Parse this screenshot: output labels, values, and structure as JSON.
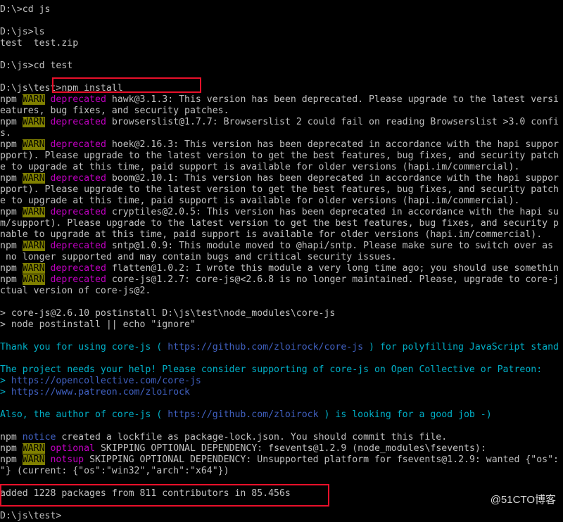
{
  "colors": {
    "default": "#c0c0c0",
    "warn_bg": "#808000",
    "warn_fg": "#000000",
    "deprecated": "#c000c0",
    "cyan": "#00b0c8",
    "notice": "#4060c0",
    "highlight": "#e8102a"
  },
  "lines": [
    [
      {
        "t": "D:\\>cd js"
      }
    ],
    [],
    [
      {
        "t": "D:\\js>ls"
      }
    ],
    [
      {
        "t": "test  test.zip"
      }
    ],
    [],
    [
      {
        "t": "D:\\js>cd test"
      }
    ],
    [],
    [
      {
        "t": "D:\\js\\test>npm install"
      }
    ],
    [
      {
        "t": "npm "
      },
      {
        "t": "WARN",
        "s": "warn"
      },
      {
        "t": " "
      },
      {
        "t": "deprecated",
        "s": "deprecated"
      },
      {
        "t": " hawk@3.1.3: This version has been deprecated. Please upgrade to the latest versi"
      }
    ],
    [
      {
        "t": "eatures, bug fixes, and security patches."
      }
    ],
    [
      {
        "t": "npm "
      },
      {
        "t": "WARN",
        "s": "warn"
      },
      {
        "t": " "
      },
      {
        "t": "deprecated",
        "s": "deprecated"
      },
      {
        "t": " browserslist@1.7.7: Browserslist 2 could fail on reading Browserslist >3.0 confi"
      }
    ],
    [
      {
        "t": "s."
      }
    ],
    [
      {
        "t": "npm "
      },
      {
        "t": "WARN",
        "s": "warn"
      },
      {
        "t": " "
      },
      {
        "t": "deprecated",
        "s": "deprecated"
      },
      {
        "t": " hoek@2.16.3: This version has been deprecated in accordance with the hapi suppor"
      }
    ],
    [
      {
        "t": "pport). Please upgrade to the latest version to get the best features, bug fixes, and security patch"
      }
    ],
    [
      {
        "t": "e to upgrade at this time, paid support is available for older versions (hapi.im/commercial)."
      }
    ],
    [
      {
        "t": "npm "
      },
      {
        "t": "WARN",
        "s": "warn"
      },
      {
        "t": " "
      },
      {
        "t": "deprecated",
        "s": "deprecated"
      },
      {
        "t": " boom@2.10.1: This version has been deprecated in accordance with the hapi suppor"
      }
    ],
    [
      {
        "t": "pport). Please upgrade to the latest version to get the best features, bug fixes, and security patch"
      }
    ],
    [
      {
        "t": "e to upgrade at this time, paid support is available for older versions (hapi.im/commercial)."
      }
    ],
    [
      {
        "t": "npm "
      },
      {
        "t": "WARN",
        "s": "warn"
      },
      {
        "t": " "
      },
      {
        "t": "deprecated",
        "s": "deprecated"
      },
      {
        "t": " cryptiles@2.0.5: This version has been deprecated in accordance with the hapi su"
      }
    ],
    [
      {
        "t": "m/support). Please upgrade to the latest version to get the best features, bug fixes, and security p"
      }
    ],
    [
      {
        "t": "nable to upgrade at this time, paid support is available for older versions (hapi.im/commercial)."
      }
    ],
    [
      {
        "t": "npm "
      },
      {
        "t": "WARN",
        "s": "warn"
      },
      {
        "t": " "
      },
      {
        "t": "deprecated",
        "s": "deprecated"
      },
      {
        "t": " sntp@1.0.9: This module moved to @hapi/sntp. Please make sure to switch over as"
      }
    ],
    [
      {
        "t": " no longer supported and may contain bugs and critical security issues."
      }
    ],
    [
      {
        "t": "npm "
      },
      {
        "t": "WARN",
        "s": "warn"
      },
      {
        "t": " "
      },
      {
        "t": "deprecated",
        "s": "deprecated"
      },
      {
        "t": " flatten@1.0.2: I wrote this module a very long time ago; you should use somethin"
      }
    ],
    [
      {
        "t": "npm "
      },
      {
        "t": "WARN",
        "s": "warn"
      },
      {
        "t": " "
      },
      {
        "t": "deprecated",
        "s": "deprecated"
      },
      {
        "t": " core-js@1.2.7: core-js@<2.6.8 is no longer maintained. Please, upgrade to core-j"
      }
    ],
    [
      {
        "t": "ctual version of core-js@2."
      }
    ],
    [],
    [
      {
        "t": "> core-js@2.6.10 postinstall D:\\js\\test\\node_modules\\core-js"
      }
    ],
    [
      {
        "t": "> node postinstall || echo \"ignore\""
      }
    ],
    [],
    [
      {
        "t": "Thank you for using core-js ( ",
        "s": "cyan"
      },
      {
        "t": "https://github.com/zloirock/core-js",
        "s": "notice"
      },
      {
        "t": " ) for polyfilling JavaScript stand",
        "s": "cyan"
      }
    ],
    [],
    [
      {
        "t": "The project needs your help! Please consider supporting of core-js on Open Collective or Patreon:",
        "s": "cyan"
      }
    ],
    [
      {
        "t": "> ",
        "s": "cyan"
      },
      {
        "t": "https://opencollective.com/core-js",
        "s": "notice"
      }
    ],
    [
      {
        "t": "> ",
        "s": "cyan"
      },
      {
        "t": "https://www.patreon.com/zloirock",
        "s": "notice"
      }
    ],
    [],
    [
      {
        "t": "Also, the author of core-js ( ",
        "s": "cyan"
      },
      {
        "t": "https://github.com/zloirock",
        "s": "notice"
      },
      {
        "t": " ) is looking for a good job -)",
        "s": "cyan"
      }
    ],
    [],
    [
      {
        "t": "npm "
      },
      {
        "t": "notice",
        "s": "notice"
      },
      {
        "t": " created a lockfile as package-lock.json. You should commit this file."
      }
    ],
    [
      {
        "t": "npm "
      },
      {
        "t": "WARN",
        "s": "warn"
      },
      {
        "t": " "
      },
      {
        "t": "optional",
        "s": "deprecated"
      },
      {
        "t": " SKIPPING OPTIONAL DEPENDENCY: fsevents@1.2.9 (node_modules\\fsevents):"
      }
    ],
    [
      {
        "t": "npm "
      },
      {
        "t": "WARN",
        "s": "warn"
      },
      {
        "t": " "
      },
      {
        "t": "notsup",
        "s": "deprecated"
      },
      {
        "t": " SKIPPING OPTIONAL DEPENDENCY: Unsupported platform for fsevents@1.2.9: wanted {\"os\":"
      }
    ],
    [
      {
        "t": "\"} (current: {\"os\":\"win32\",\"arch\":\"x64\"})"
      }
    ],
    [],
    [
      {
        "t": "added 1228 packages from 811 contributors in 85.456s"
      }
    ],
    [],
    [
      {
        "t": "D:\\js\\test>"
      }
    ]
  ],
  "watermark": "@51CTO博客"
}
